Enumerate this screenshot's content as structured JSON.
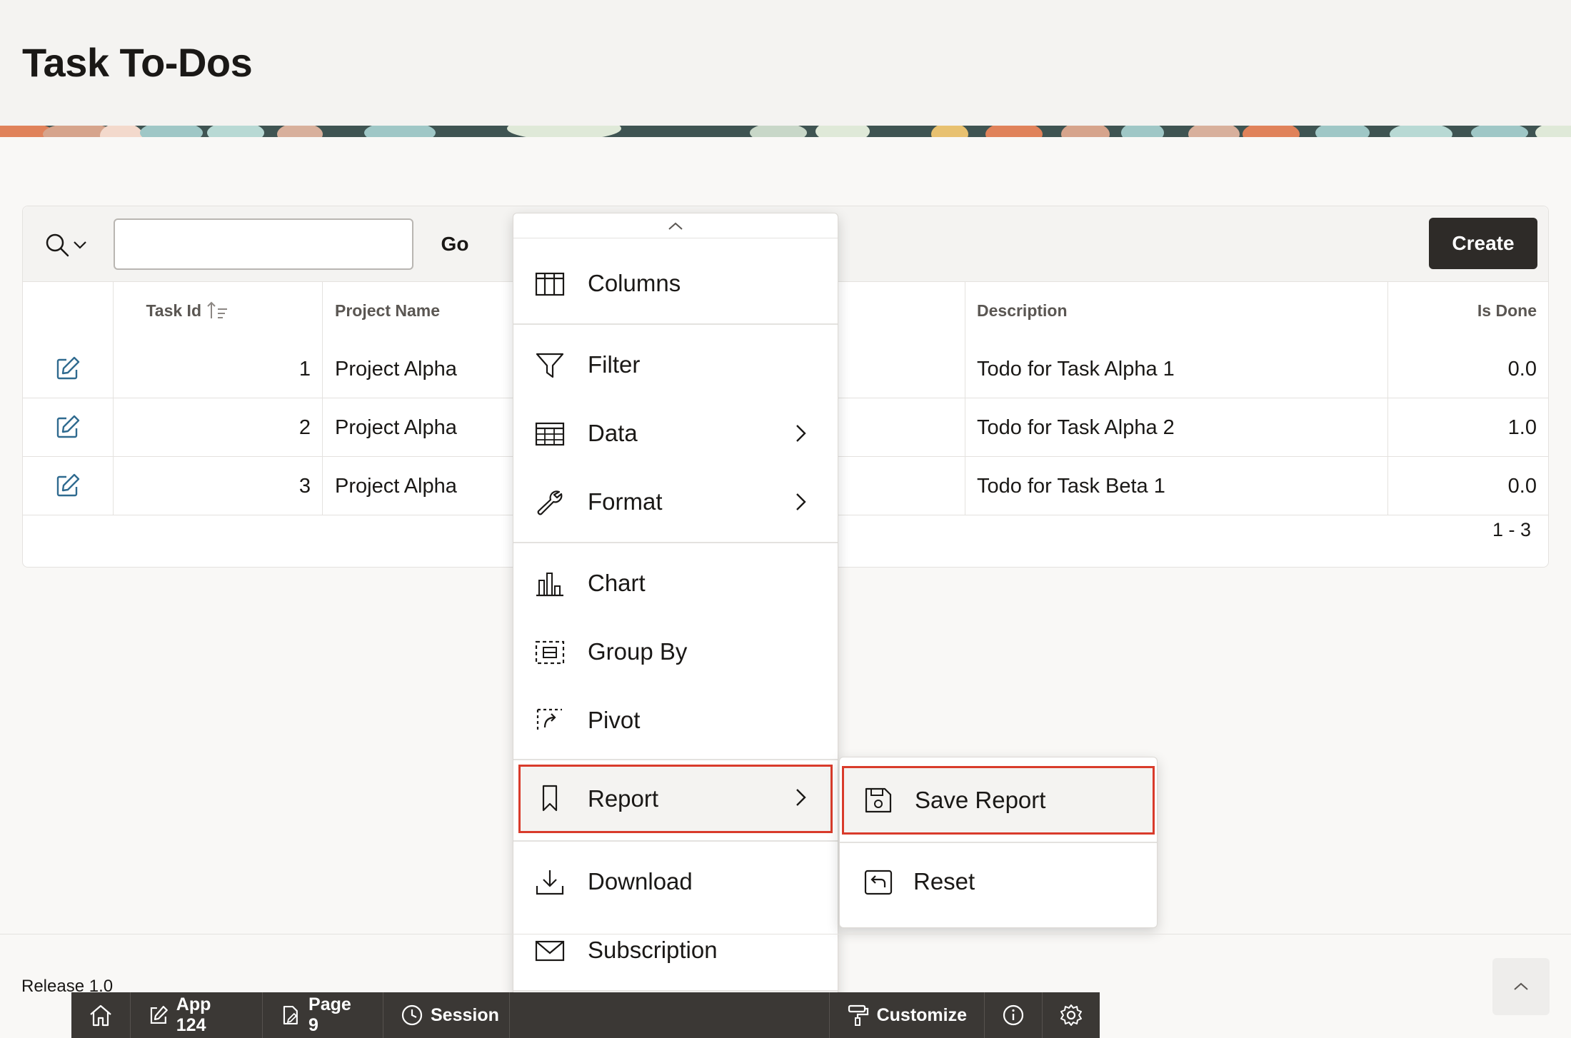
{
  "page": {
    "title": "Task To-Dos"
  },
  "toolbar": {
    "search_value": "",
    "go_label": "Go",
    "create_label": "Create"
  },
  "table": {
    "columns": [
      "Task Id",
      "Project Name",
      "Description",
      "Is Done"
    ],
    "rows": [
      {
        "task_id": "1",
        "project_name": "Project Alpha",
        "description": "Todo for Task Alpha 1",
        "is_done": "0.0"
      },
      {
        "task_id": "2",
        "project_name": "Project Alpha",
        "description": "Todo for Task Alpha 2",
        "is_done": "1.0"
      },
      {
        "task_id": "3",
        "project_name": "Project Alpha",
        "description": "Todo for Task Beta 1",
        "is_done": "0.0"
      }
    ],
    "pagination": "1 - 3"
  },
  "actions_menu": {
    "items": [
      {
        "label": "Columns",
        "icon": "columns-icon"
      },
      {
        "label": "Filter",
        "icon": "filter-icon"
      },
      {
        "label": "Data",
        "icon": "data-grid-icon",
        "submenu": true
      },
      {
        "label": "Format",
        "icon": "wrench-icon",
        "submenu": true
      },
      {
        "label": "Chart",
        "icon": "bar-chart-icon"
      },
      {
        "label": "Group By",
        "icon": "group-by-icon"
      },
      {
        "label": "Pivot",
        "icon": "pivot-icon"
      },
      {
        "label": "Report",
        "icon": "bookmark-icon",
        "submenu": true,
        "highlighted": true
      },
      {
        "label": "Download",
        "icon": "download-icon"
      },
      {
        "label": "Subscription",
        "icon": "envelope-icon"
      }
    ]
  },
  "report_submenu": {
    "items": [
      {
        "label": "Save Report",
        "icon": "save-icon",
        "highlighted": true
      },
      {
        "label": "Reset",
        "icon": "reset-icon"
      }
    ]
  },
  "footer": {
    "release": "Release 1.0"
  },
  "developer_toolbar": {
    "items": [
      {
        "label": "",
        "icon": "home-icon"
      },
      {
        "label": "App 124",
        "icon": "edit-icon"
      },
      {
        "label": "Page 9",
        "icon": "page-edit-icon"
      },
      {
        "label": "Session",
        "icon": "clock-icon"
      },
      {
        "label": "Customize",
        "icon": "paint-roller-icon"
      },
      {
        "label": "",
        "icon": "info-icon"
      },
      {
        "label": "",
        "icon": "gear-icon"
      }
    ]
  },
  "colors": {
    "highlight_border": "#d93b2b",
    "create_button": "#2e2b28",
    "dev_toolbar": "#3b3835",
    "edit_icon": "#2f6a8f"
  }
}
